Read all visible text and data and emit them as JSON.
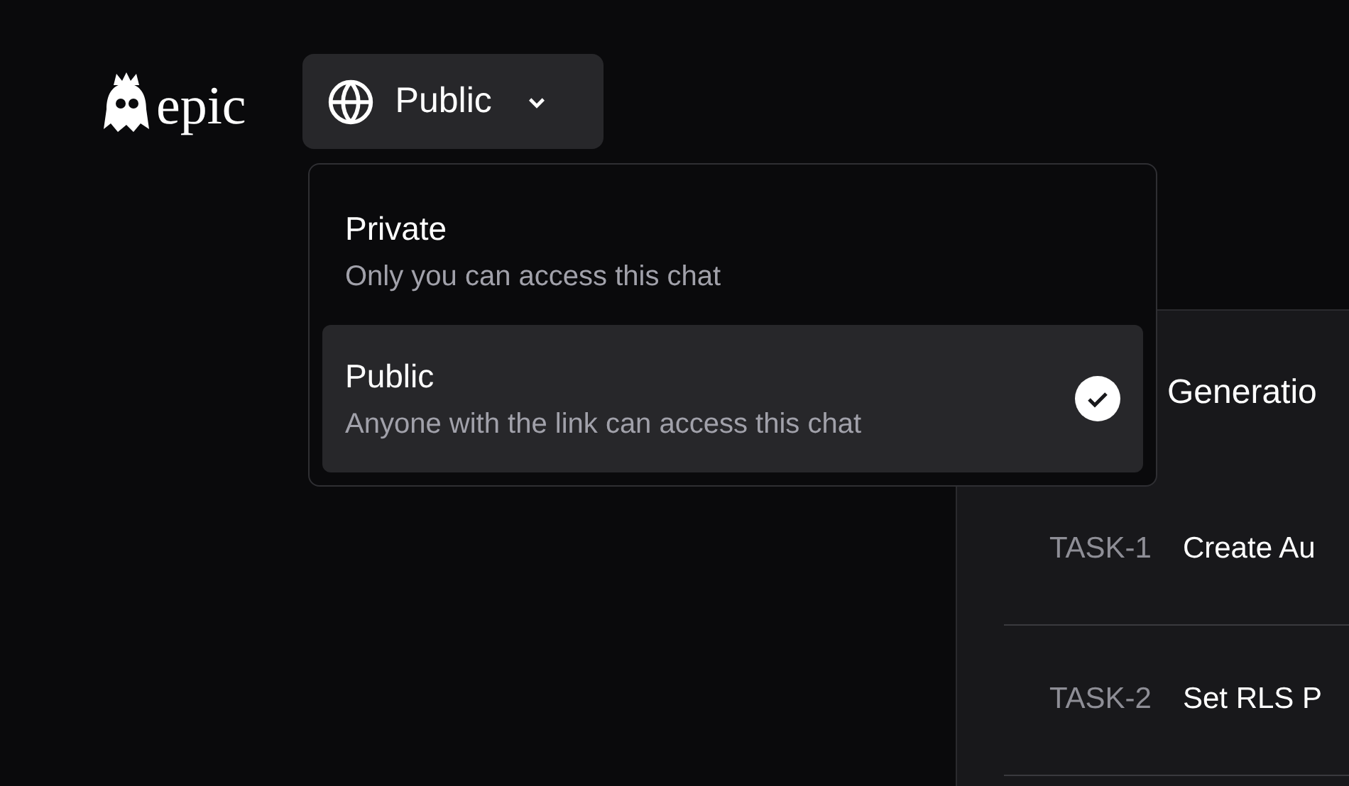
{
  "logo": {
    "text": "epic"
  },
  "visibility_button": {
    "label": "Public"
  },
  "visibility_menu": {
    "options": [
      {
        "title": "Private",
        "description": "Only you can access this chat",
        "selected": false
      },
      {
        "title": "Public",
        "description": "Anyone with the link can access this chat",
        "selected": true
      }
    ]
  },
  "panel": {
    "title": "Generatio",
    "tasks": [
      {
        "id": "TASK-1",
        "title": "Create Au"
      },
      {
        "id": "TASK-2",
        "title": "Set RLS P"
      }
    ]
  }
}
